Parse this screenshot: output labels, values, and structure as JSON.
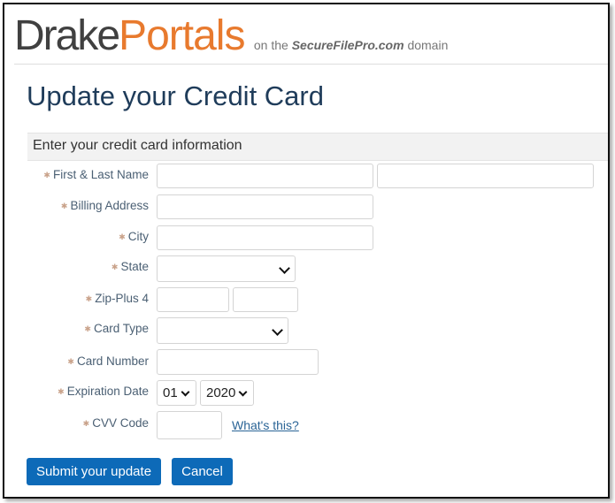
{
  "brand": {
    "name_part1": "Drake",
    "name_part2": "Portals",
    "domain_prefix": "on the",
    "domain_name": "SecureFilePro.com",
    "domain_suffix": "domain",
    "colors": {
      "drake": "#404040",
      "portals": "#e87a2e"
    }
  },
  "page": {
    "title": "Update your Credit Card",
    "section_header": "Enter your credit card information"
  },
  "form": {
    "required_marker": "✱",
    "fields": {
      "name": {
        "label": "First & Last Name",
        "first_value": "",
        "last_value": ""
      },
      "billing_address": {
        "label": "Billing Address",
        "value": ""
      },
      "city": {
        "label": "City",
        "value": ""
      },
      "state": {
        "label": "State",
        "selected": ""
      },
      "zip": {
        "label": "Zip-Plus 4",
        "zip_value": "",
        "plus4_value": ""
      },
      "card_type": {
        "label": "Card Type",
        "selected": ""
      },
      "card_number": {
        "label": "Card Number",
        "value": ""
      },
      "expiration": {
        "label": "Expiration Date",
        "month": "01",
        "year": "2020"
      },
      "cvv": {
        "label": "CVV Code",
        "value": "",
        "help_link": "What's this?"
      }
    }
  },
  "buttons": {
    "submit": "Submit your update",
    "cancel": "Cancel",
    "color": "#0d6ab8"
  }
}
